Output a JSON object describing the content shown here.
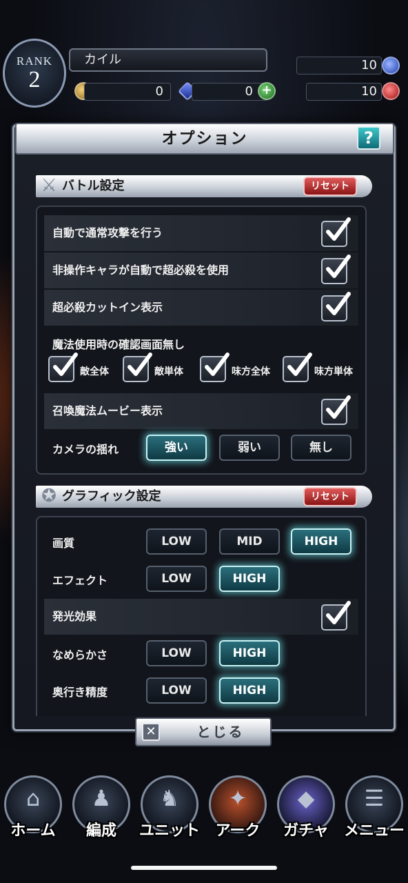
{
  "status": {
    "rank_label": "RANK",
    "rank_value": "2",
    "player_name": "カイル",
    "gold": "0",
    "crystal": "0",
    "blue_resource": "10",
    "red_resource": "10"
  },
  "dialog": {
    "title": "オプション",
    "help_label": "?",
    "close_label": "とじる",
    "close_icon": "✕"
  },
  "battle": {
    "title": "バトル設定",
    "reset_label": "リセット",
    "auto_attack": "自動で通常攻撃を行う",
    "auto_super": "非操作キャラが自動で超必殺を使用",
    "cutin": "超必殺カットイン表示",
    "magic_confirm": "魔法使用時の確認画面無し",
    "targets": [
      "敵全体",
      "敵単体",
      "味方全体",
      "味方単体"
    ],
    "summon_movie": "召喚魔法ムービー表示",
    "camera_shake": "カメラの揺れ",
    "camera_options": [
      "強い",
      "弱い",
      "無し"
    ],
    "camera_selected": "強い"
  },
  "graphic": {
    "title": "グラフィック設定",
    "reset_label": "リセット",
    "quality": "画質",
    "quality_options": [
      "LOW",
      "MID",
      "HIGH"
    ],
    "quality_selected": "HIGH",
    "effect": "エフェクト",
    "effect_options": [
      "LOW",
      "HIGH"
    ],
    "effect_selected": "HIGH",
    "glow": "発光効果",
    "smoothness": "なめらかさ",
    "smoothness_options": [
      "LOW",
      "HIGH"
    ],
    "smoothness_selected": "HIGH",
    "depth": "奥行き精度",
    "depth_options": [
      "LOW",
      "HIGH"
    ],
    "depth_selected": "HIGH"
  },
  "nav": [
    "ホーム",
    "編成",
    "ユニット",
    "アーク",
    "ガチャ",
    "メニュー"
  ],
  "colors": {
    "accent_on": "#2a6f7c",
    "reset_red": "#c53030",
    "help_teal": "#1f9aa3"
  }
}
